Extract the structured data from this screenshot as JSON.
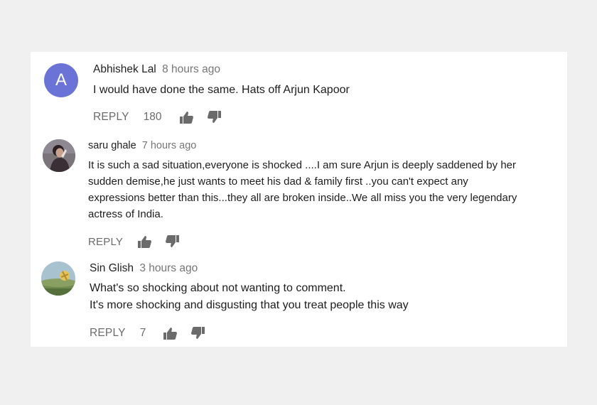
{
  "comments": [
    {
      "author": "Abhishek Lal",
      "avatar_letter": "A",
      "avatar_color": "#6b73d6",
      "time": "8 hours ago",
      "text": [
        "I would have done the same. Hats off Arjun Kapoor"
      ],
      "reply_label": "REPLY",
      "likes": "180"
    },
    {
      "author": "saru ghale",
      "time": "7 hours ago",
      "text": [
        "It is such a sad situation,everyone is shocked ....I am sure Arjun is deeply saddened by her",
        "sudden demise,he just wants to meet his dad & family first ..you can't expect any",
        "expressions better than this...they all are broken inside..We all miss you the very legendary",
        "actress of India."
      ],
      "reply_label": "REPLY",
      "likes": ""
    },
    {
      "author": "Sin Glish",
      "time": "3 hours ago",
      "text": [
        "What's  so shocking about not wanting to comment.",
        "It's more shocking and disgusting that you treat people this way"
      ],
      "reply_label": "REPLY",
      "likes": "7"
    }
  ],
  "icons": {
    "like": "thumbs-up-icon",
    "dislike": "thumbs-down-icon"
  }
}
